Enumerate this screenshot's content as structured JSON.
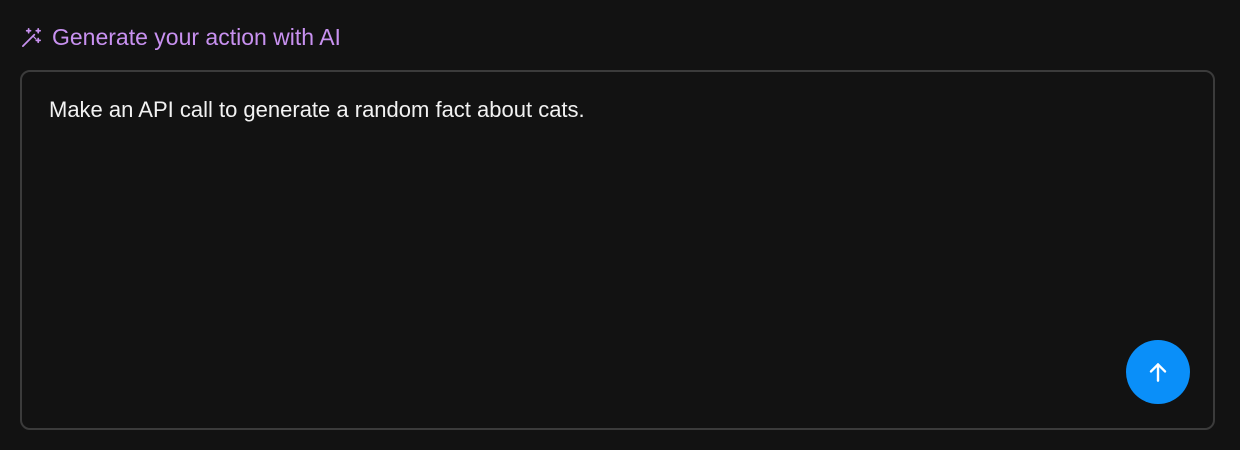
{
  "header": {
    "icon": "magic-wand-icon",
    "title": "Generate your action with AI",
    "accent_color": "#c891f0"
  },
  "prompt": {
    "value": "Make an API call to generate a random fact about cats."
  },
  "send_button": {
    "icon": "arrow-up-icon",
    "color": "#0a8ff9"
  }
}
